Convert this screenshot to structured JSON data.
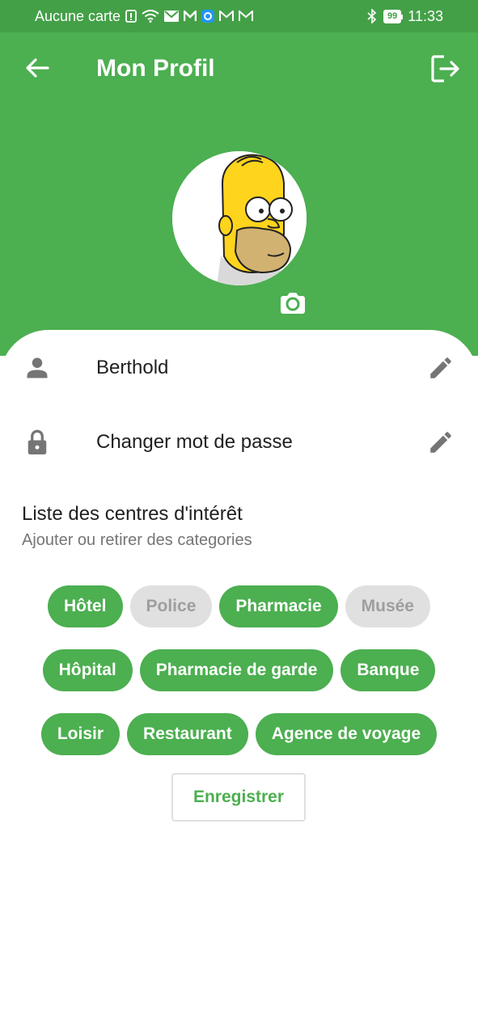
{
  "status_bar": {
    "carrier": "Aucune carte",
    "battery": "99",
    "time": "11:33",
    "icons": [
      "sim-alert-icon",
      "wifi-icon",
      "mail-icon",
      "app-icon",
      "app-icon",
      "gmail-icon",
      "gmail-icon",
      "bluetooth-icon",
      "battery-icon"
    ]
  },
  "header": {
    "title": "Mon Profil",
    "back_icon": "arrow-left-icon",
    "logout_icon": "logout-icon",
    "background_color": "#4caf50"
  },
  "profile": {
    "avatar_icon": "homer-simpson-avatar",
    "camera_icon": "camera-icon",
    "fields": [
      {
        "icon": "person-icon",
        "value": "Berthold",
        "edit_icon": "pencil-icon"
      },
      {
        "icon": "lock-icon",
        "value": "Changer mot de passe",
        "edit_icon": "pencil-icon"
      }
    ]
  },
  "interests": {
    "title": "Liste des centres d'intérêt",
    "subtitle": "Ajouter ou retirer des categories",
    "rows": [
      [
        {
          "label": "Hôtel",
          "selected": true
        },
        {
          "label": "Police",
          "selected": false
        },
        {
          "label": "Pharmacie",
          "selected": true
        },
        {
          "label": "Musée",
          "selected": false
        }
      ],
      [
        {
          "label": "Hôpital",
          "selected": true
        },
        {
          "label": "Pharmacie de garde",
          "selected": true
        },
        {
          "label": "Banque",
          "selected": true
        }
      ],
      [
        {
          "label": "Loisir",
          "selected": true
        },
        {
          "label": "Restaurant",
          "selected": true
        },
        {
          "label": "Agence de voyage",
          "selected": true
        }
      ]
    ]
  },
  "actions": {
    "save_label": "Enregistrer"
  },
  "colors": {
    "accent": "#4caf50",
    "status_bar": "#43a047",
    "chip_off": "#e0e0e0",
    "chip_off_text": "#9e9e9e"
  }
}
